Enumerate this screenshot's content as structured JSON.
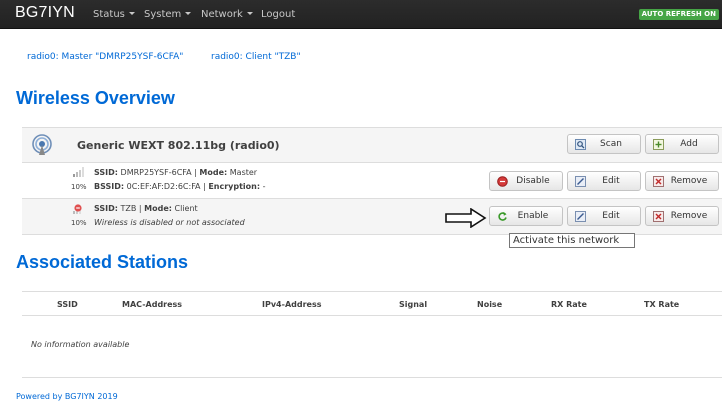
{
  "navbar": {
    "brand": "BG7IYN",
    "items": [
      "Status",
      "System",
      "Network",
      "Logout"
    ],
    "auto_refresh": "AUTO REFRESH ON"
  },
  "tabs": [
    "radio0: Master \"DMRP25YSF-6CFA\"",
    "radio0: Client \"TZB\""
  ],
  "wireless": {
    "heading": "Wireless Overview",
    "device": {
      "name": "Generic WEXT 802.11bg (radio0)",
      "icon": "wifi-device-icon",
      "buttons": [
        "Scan",
        "Add"
      ]
    },
    "networks": [
      {
        "signal_icon": "signal-bars-icon",
        "percent": "10%",
        "line1": [
          {
            "t": "SSID:",
            "b": true
          },
          {
            "t": " DMRP25YSF-6CFA | ",
            "b": false
          },
          {
            "t": "Mode:",
            "b": true
          },
          {
            "t": " Master",
            "b": false
          }
        ],
        "line2": [
          {
            "t": "BSSID:",
            "b": true
          },
          {
            "t": " 0C:EF:AF:D2:6C:FA | ",
            "b": false
          },
          {
            "t": "Encryption:",
            "b": true
          },
          {
            "t": " -",
            "b": false
          }
        ],
        "buttons": [
          "Disable",
          "Edit",
          "Remove"
        ]
      },
      {
        "signal_icon": "signal-disabled-icon",
        "percent": "10%",
        "line1": [
          {
            "t": "SSID:",
            "b": true
          },
          {
            "t": " TZB | ",
            "b": false
          },
          {
            "t": "Mode:",
            "b": true
          },
          {
            "t": " Client",
            "b": false
          }
        ],
        "line2": [
          {
            "t": "Wireless is disabled or not associated",
            "i": true
          }
        ],
        "buttons": [
          "Enable",
          "Edit",
          "Remove"
        ]
      }
    ],
    "tooltip": "Activate this network"
  },
  "stations": {
    "heading": "Associated Stations",
    "columns": [
      "SSID",
      "MAC-Address",
      "IPv4-Address",
      "Signal",
      "Noise",
      "RX Rate",
      "TX Rate"
    ],
    "empty": "No information available"
  },
  "footer": "Powered by BG7IYN 2019",
  "colors": {
    "link": "#0069d6",
    "navbar": "#222222",
    "badge": "#46a546"
  }
}
